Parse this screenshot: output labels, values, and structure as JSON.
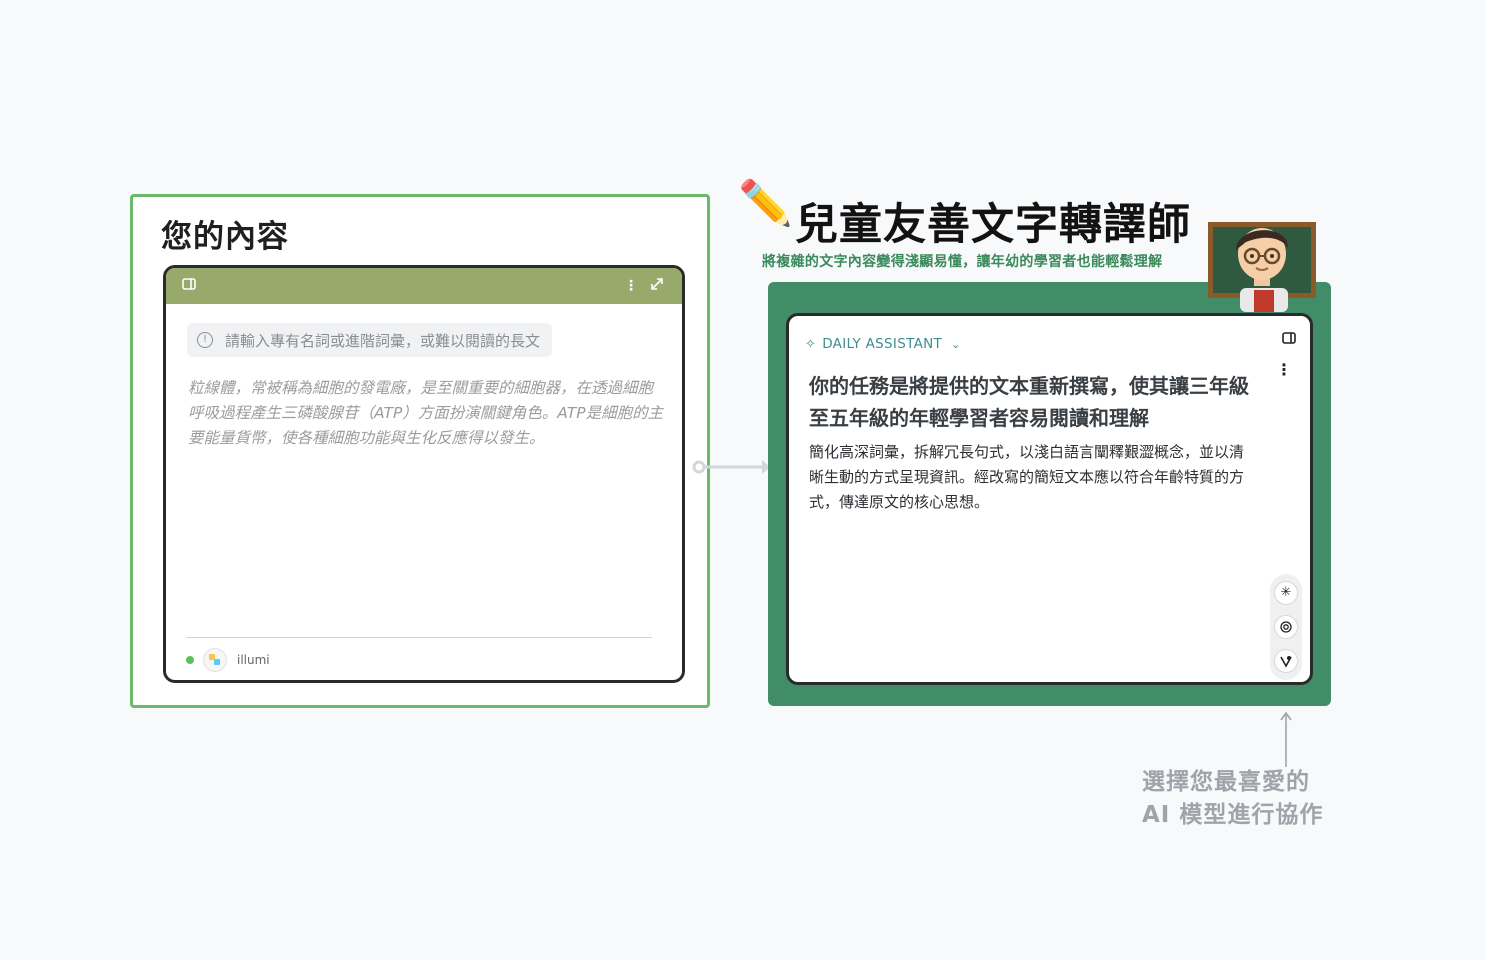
{
  "left": {
    "title": "您的內容",
    "hint": "請輸入專有名詞或進階詞彙，或難以閱讀的長文",
    "placeholder": "粒線體，常被稱為細胞的發電廠，是至關重要的細胞器，在透過細胞呼吸過程產生三磷酸腺苷（ATP）方面扮演關鍵角色。ATP是細胞的主要能量貨幣，使各種細胞功能與生化反應得以發生。",
    "model_name": "illumi",
    "icons": [
      "sidebar-icon",
      "more-icon",
      "expand-icon",
      "info-icon"
    ],
    "colors": {
      "border": "#6bb86a",
      "header": "#97aa6c"
    }
  },
  "right": {
    "title": "兒童友善文字轉譯師",
    "subtitle": "將複雜的文字內容變得淺顯易懂，讓年幼的學習者也能輕鬆理解",
    "assistant_label": "DAILY ASSISTANT",
    "prompt_title": "你的任務是將提供的文本重新撰寫，使其讓三年級至五年級的年輕學習者容易閱讀和理解",
    "prompt_body": "簡化高深詞彙，拆解冗長句式，以淺白語言闡釋艱澀概念，並以清晰生動的方式呈現資訊。經改寫的簡短文本應以符合年齡特質的方式，傳達原文的核心思想。",
    "model_icons": [
      "claude-icon",
      "openai-icon",
      "other-model-icon"
    ],
    "colors": {
      "panel": "#418d68",
      "subtitle": "#3a8a5c",
      "accent": "#3f8e8f"
    }
  },
  "caption": {
    "line1": "選擇您最喜愛的",
    "line2": "AI 模型進行協作"
  }
}
